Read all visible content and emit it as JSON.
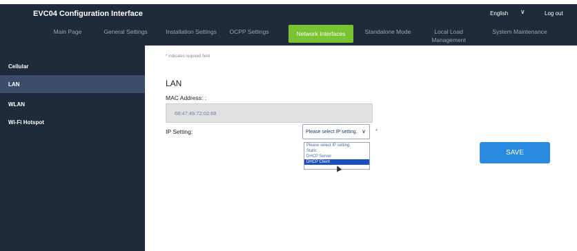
{
  "header": {
    "app_title": "EVC04 Configuration Interface",
    "language": "English",
    "logout": "Log out"
  },
  "nav": {
    "tabs": [
      {
        "label": "Main Page"
      },
      {
        "label": "General Settings"
      },
      {
        "label": "Installation Settings"
      },
      {
        "label": "OCPP Settings"
      },
      {
        "label": "Network Interfaces",
        "active": true
      },
      {
        "label": "Standalone Mode"
      },
      {
        "label": "Local Load Management"
      },
      {
        "label": "System Maintenance"
      }
    ]
  },
  "sidebar": {
    "items": [
      {
        "label": "Cellular"
      },
      {
        "label": "LAN",
        "active": true
      },
      {
        "label": "WLAN"
      },
      {
        "label": "Wi-Fi Hotspot"
      }
    ]
  },
  "main": {
    "required_note": "indicates required field",
    "section_title": "LAN",
    "mac_label": "MAC Address: :",
    "mac_value": "68:47:49:72:02:68",
    "ip_label": "IP Setting:",
    "ip_select_value": "Please select IP setting.",
    "ip_options": [
      "Please select IP setting.",
      "Static",
      "DHCP Server",
      "DHCP Client"
    ],
    "ip_options_highlighted": "DHCP Client",
    "save_label": "SAVE"
  },
  "colors": {
    "nav_bg": "#1f2a3b",
    "active_tab": "#79c231",
    "sidebar_active": "#3b4d6a",
    "save_button": "#2a8ae0",
    "highlight_option": "#1c4fbf"
  }
}
